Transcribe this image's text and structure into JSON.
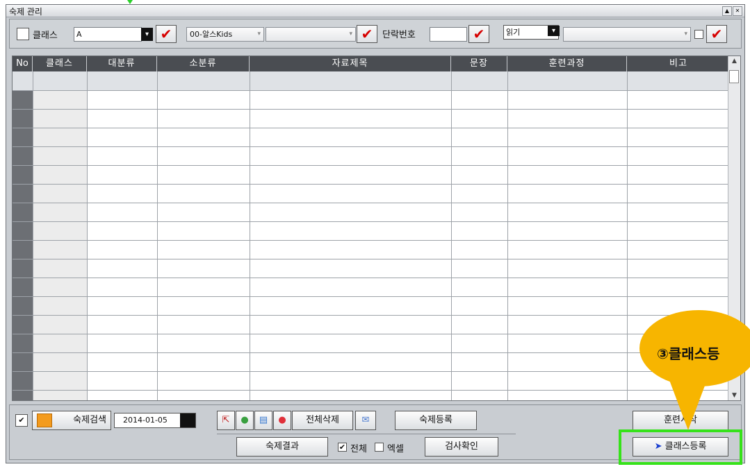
{
  "window": {
    "title": "숙제 관리"
  },
  "filter": {
    "class_label": "클래스",
    "class_value": "A",
    "program_value": "00-알스Kids",
    "paragraph_label": "단락번호",
    "mode_value": "읽기"
  },
  "grid": {
    "columns": [
      "No",
      "클래스",
      "대분류",
      "소분류",
      "자료제목",
      "문장",
      "훈련과정",
      "비고"
    ],
    "row_count": 17
  },
  "bottom": {
    "search_button": "숙제검색",
    "date_value": "2014-01-05",
    "delete_all": "전체삭제",
    "homework_register": "숙제등록",
    "homework_result": "숙제결과",
    "all_label": "전체",
    "excel_label": "엑셀",
    "check_confirm": "검사확인",
    "training_start": "훈련시작",
    "class_register": "클래스등록"
  },
  "callout": {
    "text": "③클래스등"
  },
  "colors": {
    "accent_red": "#d60000",
    "highlight_green": "#36e21a",
    "callout": "#f7b500",
    "header": "#4a4d52"
  }
}
